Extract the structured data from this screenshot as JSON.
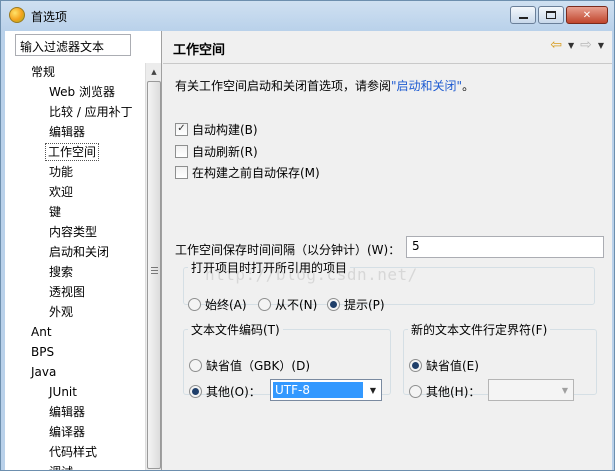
{
  "window": {
    "title": "首选项"
  },
  "filter": {
    "value": "输入过滤器文本"
  },
  "tree": {
    "items": [
      {
        "label": "常规",
        "level": 1
      },
      {
        "label": "Web 浏览器",
        "level": 2
      },
      {
        "label": "比较 / 应用补丁",
        "level": 2
      },
      {
        "label": "编辑器",
        "level": 2
      },
      {
        "label": "工作空间",
        "level": 2,
        "selected": true
      },
      {
        "label": "功能",
        "level": 2
      },
      {
        "label": "欢迎",
        "level": 2
      },
      {
        "label": "键",
        "level": 2
      },
      {
        "label": "内容类型",
        "level": 2
      },
      {
        "label": "启动和关闭",
        "level": 2
      },
      {
        "label": "搜索",
        "level": 2
      },
      {
        "label": "透视图",
        "level": 2
      },
      {
        "label": "外观",
        "level": 2
      },
      {
        "label": "Ant",
        "level": 1
      },
      {
        "label": "BPS",
        "level": 1
      },
      {
        "label": "Java",
        "level": 1
      },
      {
        "label": "JUnit",
        "level": 2
      },
      {
        "label": "编辑器",
        "level": 2
      },
      {
        "label": "编译器",
        "level": 2
      },
      {
        "label": "代码样式",
        "level": 2
      },
      {
        "label": "调试",
        "level": 2
      }
    ]
  },
  "page": {
    "title": "工作空间",
    "description": "有关工作空间启动和关闭首选项，请参阅",
    "description_link": "\"启动和关闭\"",
    "description_end": "。",
    "checkboxes": [
      {
        "label": "自动构建(B)",
        "checked": true
      },
      {
        "label": "自动刷新(R)",
        "checked": false
      },
      {
        "label": "在构建之前自动保存(M)",
        "checked": false
      }
    ],
    "interval_label": "工作空间保存时间间隔（以分钟计）(W)：",
    "interval_value": "5",
    "watermark": "http://blog.csdn.net/",
    "open_group": {
      "legend": "打开项目时打开所引用的项目",
      "options": [
        "始终(A)",
        "从不(N)",
        "提示(P)"
      ],
      "selected": 2
    },
    "encoding_group": {
      "legend": "文本文件编码(T)",
      "default_label": "缺省值（GBK）(D)",
      "other_label": "其他(O)：",
      "other_value": "UTF-8",
      "selected": "other"
    },
    "line_delim_group": {
      "legend": "新的文本文件行定界符(F)",
      "default_label": "缺省值(E)",
      "other_label": "其他(H)：",
      "other_value": "",
      "selected": "default"
    }
  },
  "icons": {
    "back": "back-arrow-icon",
    "forward": "forward-arrow-icon",
    "menu": "chevron-down-icon",
    "app": "eclipse-app-icon"
  }
}
